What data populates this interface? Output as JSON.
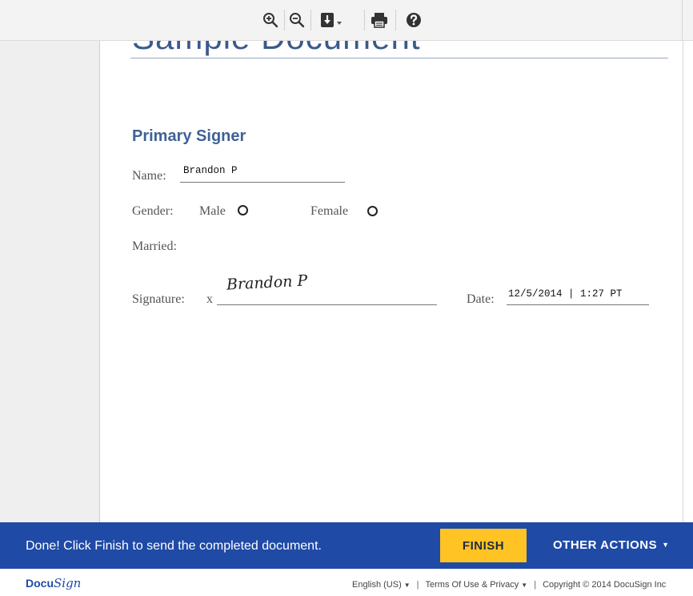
{
  "toolbar": {
    "buttons": [
      {
        "name": "zoom-in",
        "icon": "zoom-in-icon"
      },
      {
        "name": "zoom-out",
        "icon": "zoom-out-icon"
      },
      {
        "name": "download",
        "icon": "download-icon"
      },
      {
        "name": "print",
        "icon": "print-icon"
      },
      {
        "name": "help",
        "icon": "help-icon"
      }
    ]
  },
  "document": {
    "title": "Sample Document",
    "section_heading": "Primary Signer",
    "name_label": "Name:",
    "name_value": "Brandon P",
    "gender_label": "Gender:",
    "gender_options": [
      "Male",
      "Female"
    ],
    "married_label": "Married:",
    "signature_label": "Signature:",
    "signature_x": "x",
    "signature_value": "Brandon P",
    "date_label": "Date:",
    "date_value": "12/5/2014 | 1:27 PT"
  },
  "banner": {
    "message": "Done! Click Finish to send the completed document.",
    "finish_label": "FINISH",
    "other_actions_label": "OTHER ACTIONS",
    "color": "#1f4aa6",
    "finish_color": "#ffc423"
  },
  "footer": {
    "logo_part1": "Docu",
    "logo_part2": "Sign",
    "language": "English (US)",
    "terms": "Terms Of Use & Privacy",
    "copyright": "Copyright © 2014 DocuSign Inc"
  }
}
